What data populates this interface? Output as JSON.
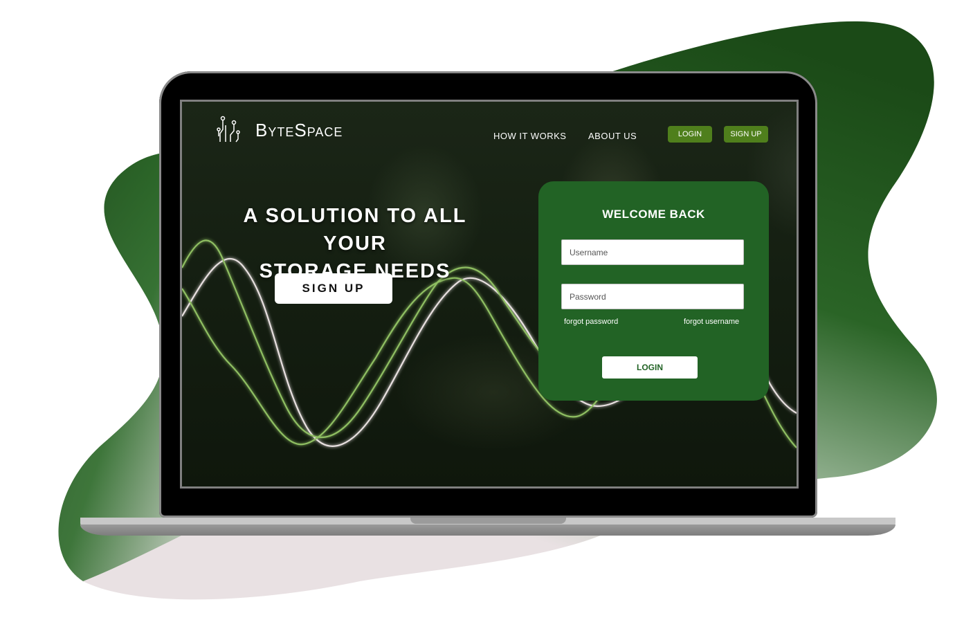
{
  "brand": {
    "name": "ByteSpace",
    "logo_icon": "circuit-icon"
  },
  "nav": {
    "links": [
      "HOW IT WORKS",
      "ABOUT US"
    ],
    "login_label": "LOGIN",
    "signup_label": "SIGN UP"
  },
  "hero": {
    "headline_line1": "A SOLUTION TO ALL YOUR",
    "headline_line2": "STORAGE NEEDS",
    "cta_label": "SIGN UP"
  },
  "login_card": {
    "title": "WELCOME BACK",
    "username_placeholder": "Username",
    "password_placeholder": "Password",
    "forgot_password": "forgot password",
    "forgot_username": "forgot username",
    "submit_label": "LOGIN"
  },
  "colors": {
    "card_bg": "#226325",
    "nav_button": "#4f7f1c",
    "wave_green": "#8fbf62",
    "wave_white": "#e8e0e0"
  }
}
